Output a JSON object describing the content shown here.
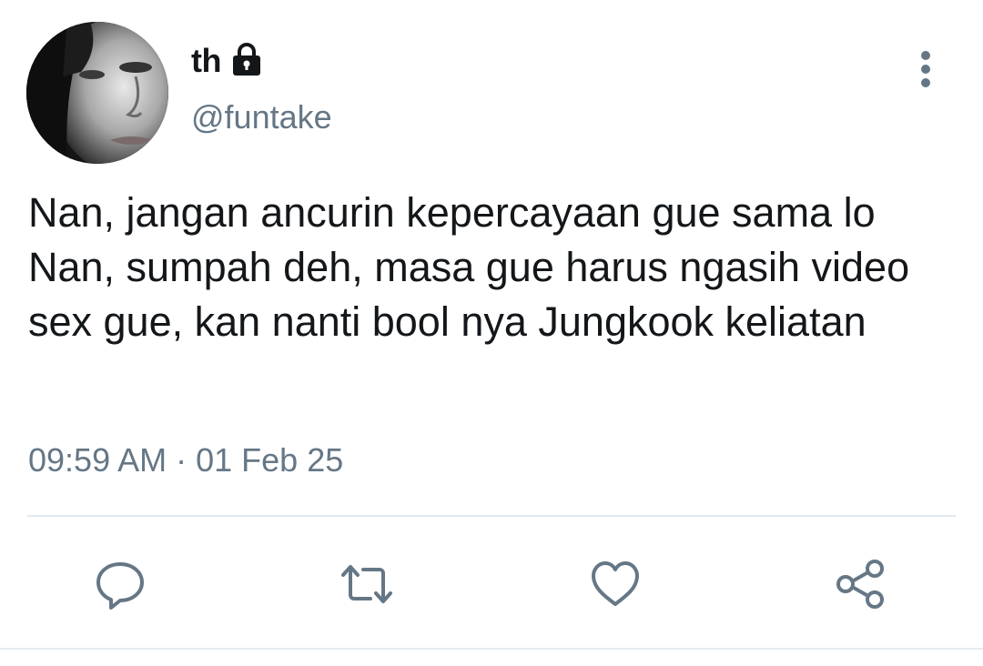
{
  "user": {
    "display_name": "th",
    "handle": "@funtake",
    "protected_icon": "lock-icon",
    "avatar_icon": "profile-photo"
  },
  "tweet": {
    "text": "Nan, jangan ancurin kepercayaan gue sama lo Nan, sumpah deh, masa gue harus ngasih video sex gue, kan nanti bool nya Jungkook keliatan",
    "time": "09:59 AM",
    "separator": "·",
    "date": "01 Feb 25"
  },
  "actions": [
    {
      "name": "reply",
      "icon": "comment-icon"
    },
    {
      "name": "retweet",
      "icon": "retweet-icon"
    },
    {
      "name": "like",
      "icon": "heart-icon"
    },
    {
      "name": "share",
      "icon": "share-icon"
    }
  ],
  "colors": {
    "text": "#14171a",
    "secondary": "#657786",
    "divider": "#e1e8ed"
  }
}
